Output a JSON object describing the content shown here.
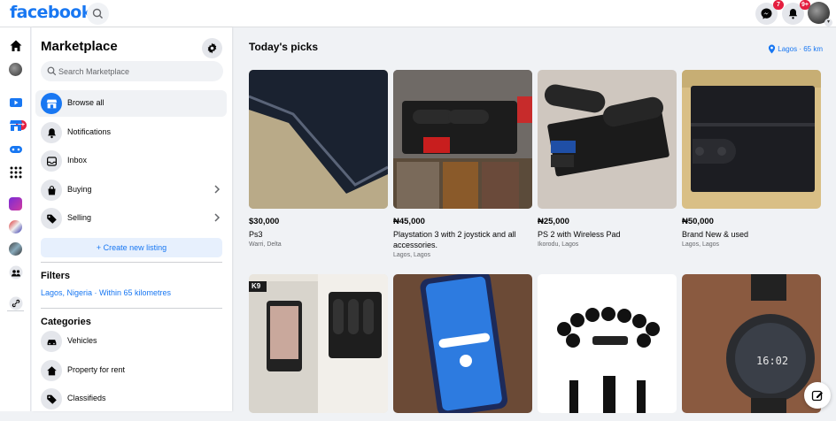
{
  "header": {
    "logo": "facebook",
    "messenger_badge": "7",
    "notifications_badge": "9+",
    "brand_color": "#1877f2"
  },
  "rail": {
    "badge": "9+"
  },
  "sidebar": {
    "title": "Marketplace",
    "search_placeholder": "Search Marketplace",
    "nav": [
      {
        "label": "Browse all",
        "icon": "storefront-icon"
      },
      {
        "label": "Notifications",
        "icon": "bell-icon"
      },
      {
        "label": "Inbox",
        "icon": "inbox-icon"
      },
      {
        "label": "Buying",
        "icon": "shopping-bag-icon"
      },
      {
        "label": "Selling",
        "icon": "tag-icon"
      }
    ],
    "create_label": "+  Create new listing",
    "filters_title": "Filters",
    "filters_value": "Lagos, Nigeria · Within 65 kilometres",
    "categories_title": "Categories",
    "categories": [
      {
        "label": "Vehicles",
        "icon": "car-icon"
      },
      {
        "label": "Property for rent",
        "icon": "house-icon"
      },
      {
        "label": "Classifieds",
        "icon": "tag-icon"
      }
    ]
  },
  "main": {
    "title": "Today's picks",
    "location": "Lagos · 65 km",
    "listings": [
      {
        "price": "$30,000",
        "title": "Ps3",
        "location": "Warri, Delta"
      },
      {
        "price": "₦45,000",
        "title": "Playstation 3 with 2 joystick and all accessories.",
        "location": "Lagos, Lagos"
      },
      {
        "price": "₦25,000",
        "title": "PS 2 with Wireless Pad",
        "location": "Ikorodu, Lagos"
      },
      {
        "price": "₦50,000",
        "title": "Brand New & used",
        "location": "Lagos, Lagos"
      },
      {
        "price": "",
        "title": "",
        "location": "",
        "photo_text": "K9"
      },
      {
        "price": "",
        "title": "",
        "location": ""
      },
      {
        "price": "",
        "title": "",
        "location": ""
      },
      {
        "price": "",
        "title": "",
        "location": "",
        "photo_text": "16:02"
      }
    ]
  }
}
